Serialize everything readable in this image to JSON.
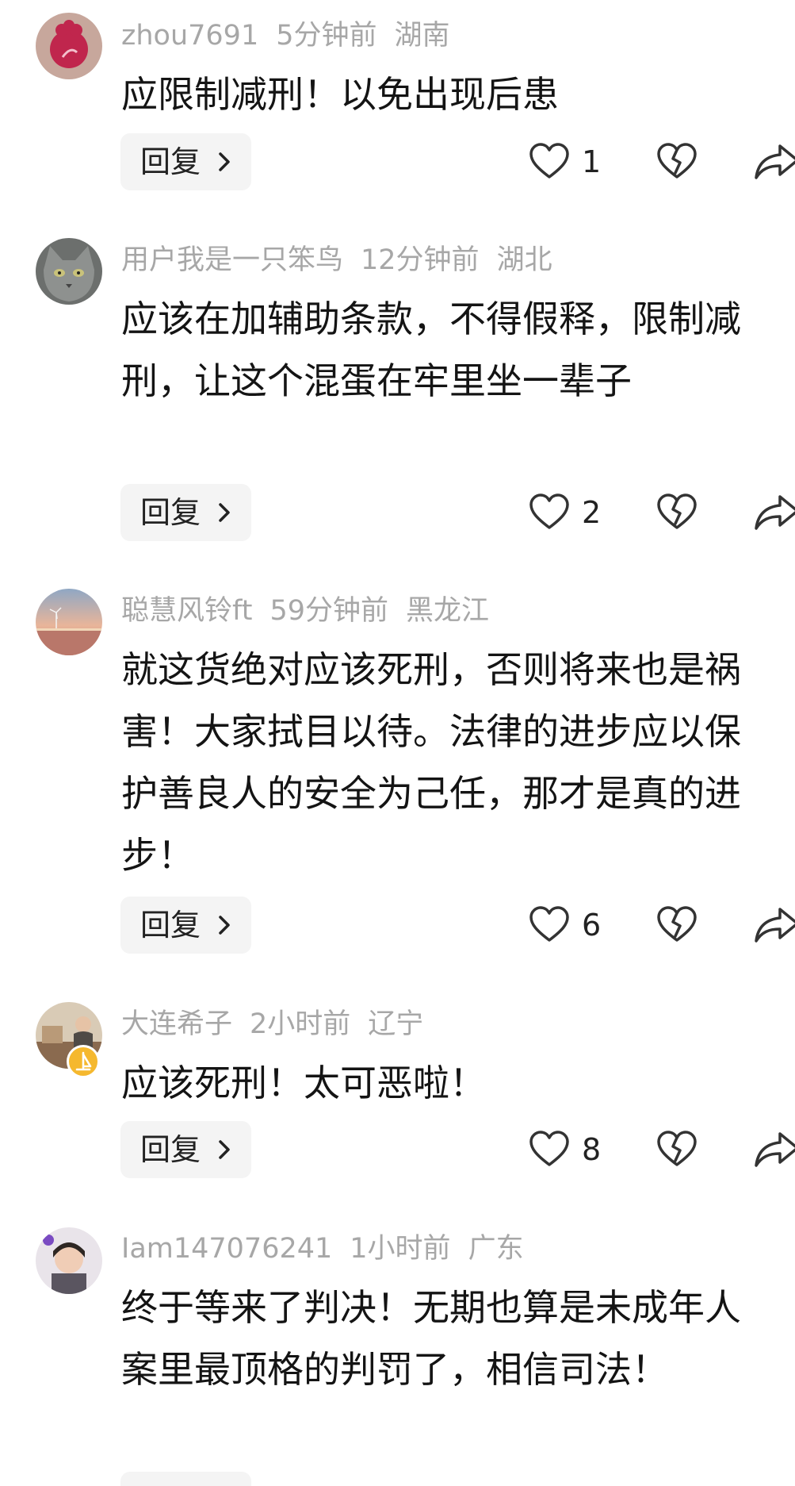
{
  "reply_label": "回复",
  "comments": [
    {
      "username": "zhou7691",
      "time": "5分钟前",
      "location": "湖南",
      "text": "应限制减刑！以免出现后患",
      "likes": "1",
      "avatar": "red-flower-avatar"
    },
    {
      "username": "用户我是一只笨鸟",
      "time": "12分钟前",
      "location": "湖北",
      "text": "应该在加辅助条款，不得假释，限制减刑，让这个混蛋在牢里坐一辈子",
      "likes": "2",
      "avatar": "cat-avatar"
    },
    {
      "username": "聪慧风铃ft",
      "time": "59分钟前",
      "location": "黑龙江",
      "text": "就这货绝对应该死刑，否则将来也是祸害！大家拭目以待。法律的进步应以保护善良人的安全为己任，那才是真的进步！",
      "likes": "6",
      "avatar": "sunset-beach-avatar"
    },
    {
      "username": "大连希子",
      "time": "2小时前",
      "location": "辽宁",
      "text": "应该死刑！太可恶啦！",
      "likes": "8",
      "avatar": "person-photo-avatar"
    },
    {
      "username": "Iam147076241",
      "time": "1小时前",
      "location": "广东",
      "text": "终于等来了判决！无期也算是未成年人案里最顶格的判罚了，相信司法！",
      "likes": "",
      "avatar": "child-photo-avatar"
    }
  ],
  "colors": {
    "meta_text": "#a7a7a7",
    "body_text": "#141414",
    "reply_bg": "#f4f4f4",
    "icon_stroke": "#333333",
    "badge": "#f5b82e"
  }
}
